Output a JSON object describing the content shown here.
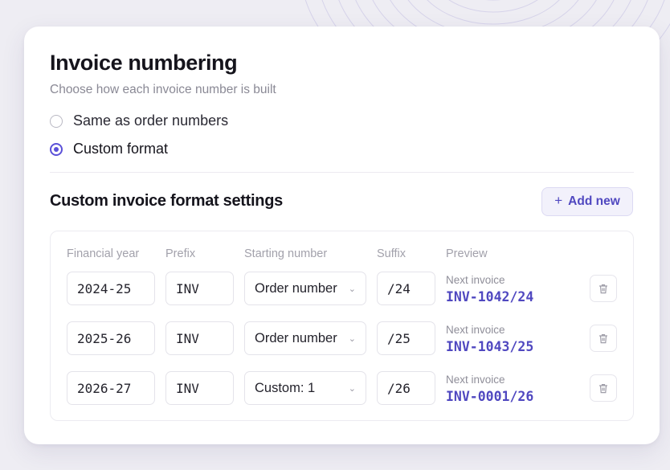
{
  "card": {
    "title": "Invoice numbering",
    "subtitle": "Choose how each invoice number is built",
    "options": [
      {
        "label": "Same as order numbers",
        "checked": false
      },
      {
        "label": "Custom format",
        "checked": true
      }
    ]
  },
  "section": {
    "title": "Custom invoice format settings",
    "add_label": "Add new",
    "add_icon": "plus-icon"
  },
  "table": {
    "headers": [
      "Financial year",
      "Prefix",
      "Starting number",
      "Suffix",
      "Preview"
    ],
    "rows": [
      {
        "year": "2024-25",
        "prefix": "INV",
        "start": "Order number",
        "suffix": "/24",
        "preview_label": "Next invoice",
        "preview_value": "INV-1042/24"
      },
      {
        "year": "2025-26",
        "prefix": "INV",
        "start": "Order number",
        "suffix": "/25",
        "preview_label": "Next invoice",
        "preview_value": "INV-1043/25"
      },
      {
        "year": "2026-27",
        "prefix": "INV",
        "start": "Custom: 1",
        "suffix": "/26",
        "preview_label": "Next invoice",
        "preview_value": "INV-0001/26"
      }
    ]
  },
  "colors": {
    "accent": "#5b51d8",
    "preview_text": "#5048c0",
    "background": "#eeedf3"
  }
}
